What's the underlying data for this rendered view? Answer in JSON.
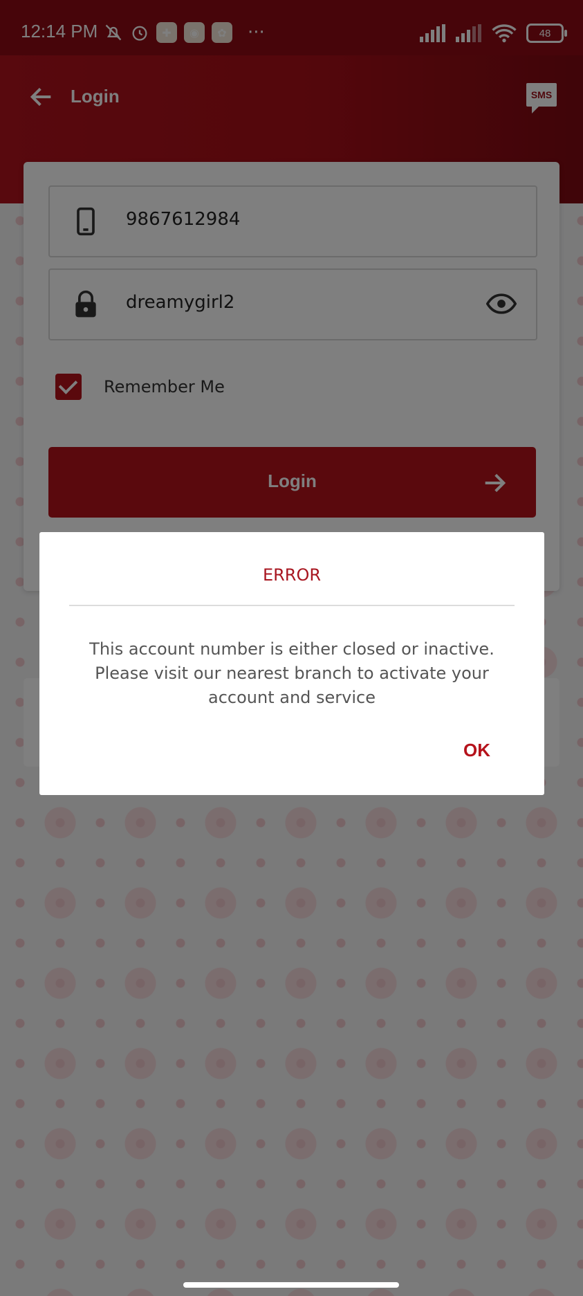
{
  "status_bar": {
    "time": "12:14 PM",
    "battery": "48"
  },
  "toolbar": {
    "title": "Login",
    "sms_label": "SMS"
  },
  "form": {
    "mobile_value": "9867612984",
    "password_value": "dreamygirl2",
    "remember_label": "Remember Me",
    "remember_checked": true,
    "login_label": "Login"
  },
  "dialog": {
    "title": "ERROR",
    "message": "This account number is either closed or inactive. Please visit our nearest branch to activate your account and service",
    "ok_label": "OK"
  },
  "colors": {
    "brand": "#b5121b",
    "header": "#a70e18"
  }
}
